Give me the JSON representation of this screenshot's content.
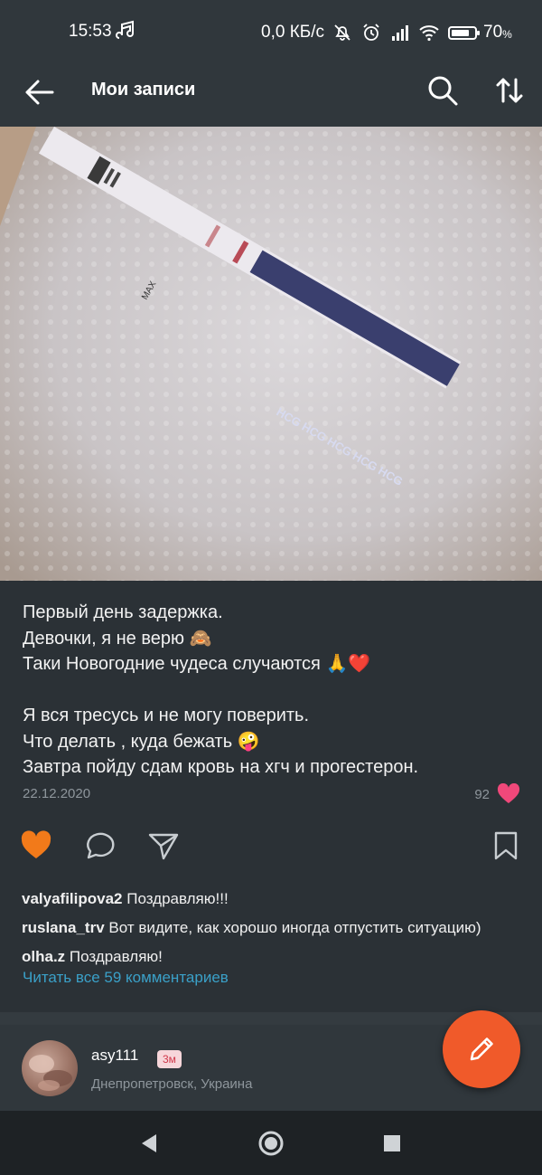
{
  "status_bar": {
    "time": "15:53",
    "network_speed": "0,0 КБ/с",
    "battery": "70",
    "battery_unit": "%",
    "icons": [
      "music-note-icon",
      "mute-icon",
      "alarm-icon",
      "signal-icon",
      "wifi-icon",
      "battery-icon"
    ]
  },
  "header": {
    "title": "Мои записи",
    "icons": [
      "back-arrow-icon",
      "search-icon",
      "sort-icon"
    ]
  },
  "photo": {
    "strip_text": "HCG HCG HCG HCG HCG",
    "max_label": "MAX"
  },
  "post": {
    "caption_lines": [
      "Первый день задержка.",
      "Девочки, я не верю 🙈",
      "Таки Новогодние чудеса случаются 🙏❤️",
      "",
      "Я вся тресусь и не могу поверить.",
      "Что делать , куда бежать 🤪",
      "Завтра пойду сдам кровь на хгч и прогестерон."
    ],
    "date": "22.12.2020",
    "likes_count": "92"
  },
  "actions": {
    "icons": [
      "heart-icon",
      "comment-icon",
      "share-icon",
      "bookmark-icon"
    ],
    "colors": {
      "liked": "#f27a1a",
      "like_badge": "#f0487a"
    }
  },
  "comments": [
    {
      "user": "valyafilipova2",
      "text": "Поздравляю!!!"
    },
    {
      "user": "ruslana_trv",
      "text": "Вот видите, как хорошо иногда отпустить ситуацию)"
    },
    {
      "user": "olha.z",
      "text": "Поздравляю!"
    }
  ],
  "read_all_comments": "Читать все 59 комментариев",
  "author": {
    "name": "asy111",
    "time_ago": "3м",
    "location": "Днепропетровск, Украина"
  },
  "fab": {
    "icon": "pencil-icon",
    "color": "#f05a2a"
  },
  "nav_bar": {
    "icons": [
      "nav-back-icon",
      "nav-home-icon",
      "nav-recents-icon"
    ]
  }
}
